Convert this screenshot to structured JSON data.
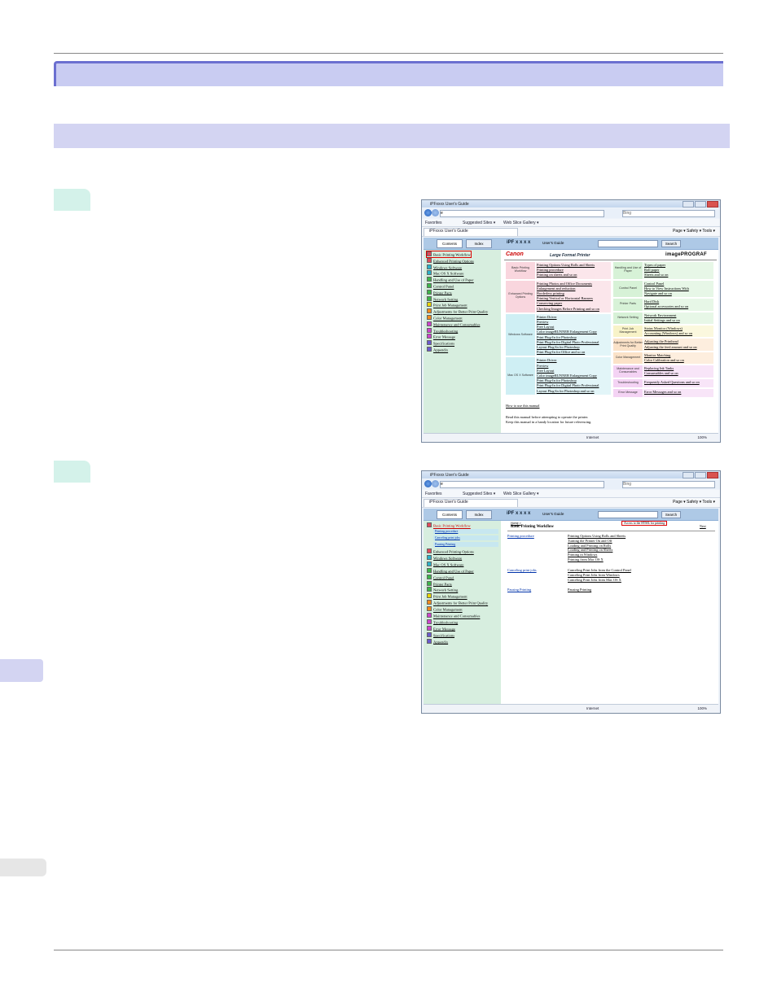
{
  "shot1": {
    "window_title": "iPFxxxx User's Guide",
    "address_value": "e",
    "search_placeholder": "Bing",
    "favorites_label": "Favorites",
    "suggested_sites": "Suggested Sites ▾",
    "web_slice": "Web Slice Gallery ▾",
    "ie_tab": "iPFxxxx User's Guide",
    "tools": "Page ▾   Safety ▾   Tools ▾",
    "tab_contents": "Contents",
    "tab_index": "Index",
    "brand": "iPF x x x x",
    "guide": "User's Guide",
    "search_btn": "Search",
    "status": "Internet",
    "zoom": "100%",
    "sidebar": [
      {
        "label": "Basic Printing Workflow",
        "color": "#e24a5a"
      },
      {
        "label": "Enhanced Printing Options",
        "color": "#e24a5a"
      },
      {
        "label": "Windows Software",
        "color": "#2bb0c8"
      },
      {
        "label": "Mac OS X Software",
        "color": "#2bb0c8"
      },
      {
        "label": "Handling and Use of Paper",
        "color": "#3cb54a"
      },
      {
        "label": "Control Panel",
        "color": "#3cb54a"
      },
      {
        "label": "Printer Parts",
        "color": "#3cb54a"
      },
      {
        "label": "Network Setting",
        "color": "#3cb54a"
      },
      {
        "label": "Print Job Management",
        "color": "#e8d400"
      },
      {
        "label": "Adjustments for Better Print Quality",
        "color": "#f08a1c"
      },
      {
        "label": "Color Management",
        "color": "#f08a1c"
      },
      {
        "label": "Maintenance and Consumables",
        "color": "#cc44cc"
      },
      {
        "label": "Troubleshooting",
        "color": "#cc44cc"
      },
      {
        "label": "Error Message",
        "color": "#cc44cc"
      },
      {
        "label": "Specifications",
        "color": "#6a5acd"
      },
      {
        "label": "Appendix",
        "color": "#6a5acd"
      }
    ],
    "logo_canon": "Canon",
    "logo_lfp": "Large Format Printer",
    "logo_ip": "imagePROGRAF",
    "left_cats": [
      {
        "name": "Basic Printing Workflow",
        "color": "#f9d6de",
        "links": [
          "Printing Options Using Rolls and Sheets",
          "Printing procedure",
          "Printing on sheets and so on"
        ]
      },
      {
        "name": "Enhanced Printing Options",
        "color": "#f9d6de",
        "links": [
          "Printing Photos and Office Documents",
          "Enlargement and reduction",
          "Borderless printing",
          "Printing Vertical or Horizontal Banners",
          "Conserving paper",
          "Checking Images Before Printing and so on"
        ]
      },
      {
        "name": "Windows Software",
        "color": "#cfeff4",
        "links": [
          "Printer Driver",
          "Preview",
          "Free Layout",
          "Color imageRUNNER Enlargement Copy",
          "Print Plug-In for Photoshop",
          "Print Plug-In for Digital Photo Professional",
          "Layout Plug-In for Photoshop",
          "Print Plug-In for Office and so on"
        ]
      },
      {
        "name": "Mac OS X Software",
        "color": "#cfeff4",
        "links": [
          "Printer Driver",
          "Preview",
          "Free Layout",
          "Color imageRUNNER Enlargement Copy",
          "Print Plug-In for Photoshop",
          "Print Plug-In for Digital Photo Professional",
          "Layout Plug-In for Photoshop and so on"
        ]
      }
    ],
    "right_cats": [
      {
        "name": "Handling and Use of Paper",
        "color": "#d7f2d7",
        "links": [
          "Types of paper",
          "Roll paper",
          "Sheets and so on"
        ]
      },
      {
        "name": "Control Panel",
        "color": "#d7f2d7",
        "links": [
          "Control Panel",
          "How to View Instructions With",
          "Navigate and so on"
        ]
      },
      {
        "name": "Printer Parts",
        "color": "#d7f2d7",
        "links": [
          "Hard Disk",
          "Optional accessories and so on"
        ]
      },
      {
        "name": "Network Setting",
        "color": "#d7f2d7",
        "links": [
          "Network Environment",
          "Initial Settings and so on"
        ]
      },
      {
        "name": "Print Job Management",
        "color": "#f8f3c8",
        "links": [
          "Status Monitor (Windows)",
          "Accounting (Windows) and so on"
        ]
      },
      {
        "name": "Adjustments for Better Print Quality",
        "color": "#fbe2c8",
        "links": [
          "Adjusting the Printhead",
          "Adjusting the feed amount and so on"
        ]
      },
      {
        "name": "Color Management",
        "color": "#fbe2c8",
        "links": [
          "Monitor Matching",
          "Color Calibration and so on"
        ]
      },
      {
        "name": "Maintenance and Consumables",
        "color": "#f4d3f4",
        "links": [
          "Replacing Ink Tanks",
          "Consumables and so on"
        ]
      },
      {
        "name": "Troubleshooting",
        "color": "#f4d3f4",
        "links": [
          "Frequently Asked Questions and so on"
        ]
      },
      {
        "name": "Error Message",
        "color": "#f4d3f4",
        "links": [
          "Error Messages and so on"
        ]
      }
    ],
    "footer_link": "How to use this manual",
    "footer_lines": [
      "Read this manual before attempting to operate the printer.",
      "Keep this manual in a handy location for future referencing."
    ]
  },
  "shot2": {
    "window_title": "iPFxxxx User's Guide",
    "address_value": "e",
    "search_placeholder": "Bing",
    "favorites_label": "Favorites",
    "suggested_sites": "Suggested Sites ▾",
    "web_slice": "Web Slice Gallery ▾",
    "ie_tab": "iPFxxxx User's Guide",
    "tools": "Page ▾   Safety ▾   Tools ▾",
    "tab_contents": "Contents",
    "tab_index": "Index",
    "brand": "iPF x x x x",
    "guide": "User's Guide",
    "search_btn": "Search",
    "status": "Internet",
    "zoom": "100%",
    "sidebar_top": "Basic Printing Workflow",
    "sidebar_subs": [
      "Printing procedure",
      "Canceling print jobs",
      "Pausing Printing"
    ],
    "sidebar_rest": [
      {
        "label": "Enhanced Printing Options",
        "color": "#e24a5a"
      },
      {
        "label": "Windows Software",
        "color": "#2bb0c8"
      },
      {
        "label": "Mac OS X Software",
        "color": "#2bb0c8"
      },
      {
        "label": "Handling and Use of Paper",
        "color": "#3cb54a"
      },
      {
        "label": "Control Panel",
        "color": "#3cb54a"
      },
      {
        "label": "Printer Parts",
        "color": "#3cb54a"
      },
      {
        "label": "Network Setting",
        "color": "#3cb54a"
      },
      {
        "label": "Print Job Management",
        "color": "#e8d400"
      },
      {
        "label": "Adjustments for Better Print Quality",
        "color": "#f08a1c"
      },
      {
        "label": "Color Management",
        "color": "#f08a1c"
      },
      {
        "label": "Maintenance and Consumables",
        "color": "#cc44cc"
      },
      {
        "label": "Troubleshooting",
        "color": "#cc44cc"
      },
      {
        "label": "Error Message",
        "color": "#cc44cc"
      },
      {
        "label": "Specifications",
        "color": "#6a5acd"
      },
      {
        "label": "Appendix",
        "color": "#6a5acd"
      }
    ],
    "breadcrumb": "Home >",
    "page_heading": "Basic Printing Workflow",
    "html_link": "Access to the HTML for printing",
    "next": "Next",
    "sections": [
      {
        "title": "Printing procedure",
        "links": [
          "Printing Options Using Rolls and Sheets",
          "Turning the Printer On and Off",
          "Loading and Printing on Rolls",
          "Loading and Printing on Sheets",
          "Printing in Windows",
          "Printing from Mac OS X"
        ]
      },
      {
        "title": "Canceling print jobs",
        "links": [
          "Canceling Print Jobs from the Control Panel",
          "Canceling Print Jobs from Windows",
          "Canceling Print Jobs from Mac OS X"
        ]
      },
      {
        "title": "Pausing Printing",
        "links": [
          "Pausing Printing"
        ]
      }
    ]
  }
}
